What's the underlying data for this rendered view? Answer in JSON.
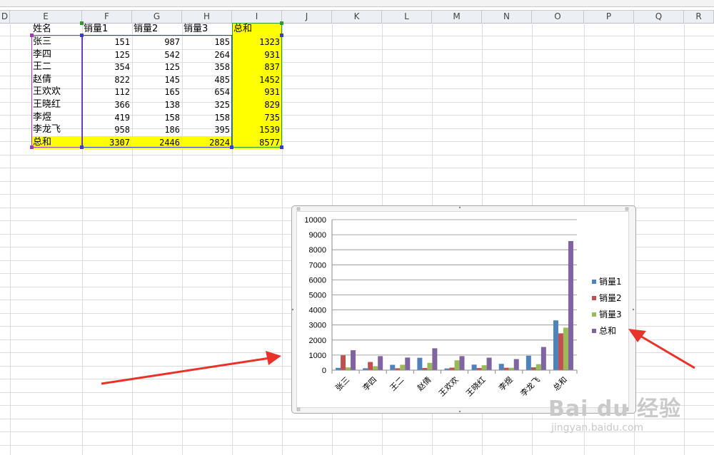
{
  "columns": [
    "D",
    "E",
    "F",
    "G",
    "H",
    "I",
    "J",
    "K",
    "L",
    "M",
    "N",
    "O",
    "P",
    "Q",
    "R"
  ],
  "table": {
    "headers": [
      "姓名",
      "销量1",
      "销量2",
      "销量3",
      "总和"
    ],
    "rows": [
      {
        "name": "张三",
        "v1": "151",
        "v2": "987",
        "v3": "185",
        "total": "1323"
      },
      {
        "name": "李四",
        "v1": "125",
        "v2": "542",
        "v3": "264",
        "total": "931"
      },
      {
        "name": "王二",
        "v1": "354",
        "v2": "125",
        "v3": "358",
        "total": "837"
      },
      {
        "name": "赵倩",
        "v1": "822",
        "v2": "145",
        "v3": "485",
        "total": "1452"
      },
      {
        "name": "王欢欢",
        "v1": "112",
        "v2": "165",
        "v3": "654",
        "total": "931"
      },
      {
        "name": "王晓红",
        "v1": "366",
        "v2": "138",
        "v3": "325",
        "total": "829"
      },
      {
        "name": "李煜",
        "v1": "419",
        "v2": "158",
        "v3": "158",
        "total": "735"
      },
      {
        "name": "李龙飞",
        "v1": "958",
        "v2": "186",
        "v3": "395",
        "total": "1539"
      }
    ],
    "sum_row": {
      "name": "总和",
      "v1": "3307",
      "v2": "2446",
      "v3": "2824",
      "total": "8577"
    }
  },
  "colors": {
    "highlight": "#ffff00",
    "series": [
      "#4f81bd",
      "#c0504d",
      "#9bbb59",
      "#8064a2"
    ],
    "arrow": "#e8332b"
  },
  "chart_data": {
    "type": "bar",
    "categories": [
      "张三",
      "李四",
      "王二",
      "赵倩",
      "王欢欢",
      "王晓红",
      "李煜",
      "李龙飞",
      "总和"
    ],
    "series": [
      {
        "name": "销量1",
        "values": [
          151,
          125,
          354,
          822,
          112,
          366,
          419,
          958,
          3307
        ]
      },
      {
        "name": "销量2",
        "values": [
          987,
          542,
          125,
          145,
          165,
          138,
          158,
          186,
          2446
        ]
      },
      {
        "name": "销量3",
        "values": [
          185,
          264,
          358,
          485,
          654,
          325,
          158,
          395,
          2824
        ]
      },
      {
        "name": "总和",
        "values": [
          1323,
          931,
          837,
          1452,
          931,
          829,
          735,
          1539,
          8577
        ]
      }
    ],
    "yticks": [
      "0",
      "1000",
      "2000",
      "3000",
      "4000",
      "5000",
      "6000",
      "7000",
      "8000",
      "9000",
      "10000"
    ],
    "ylim": [
      0,
      10000
    ],
    "grid": true,
    "legend": "right"
  },
  "watermark": {
    "brand": "Bai du 经验",
    "url": "jingyan.baidu.com"
  }
}
